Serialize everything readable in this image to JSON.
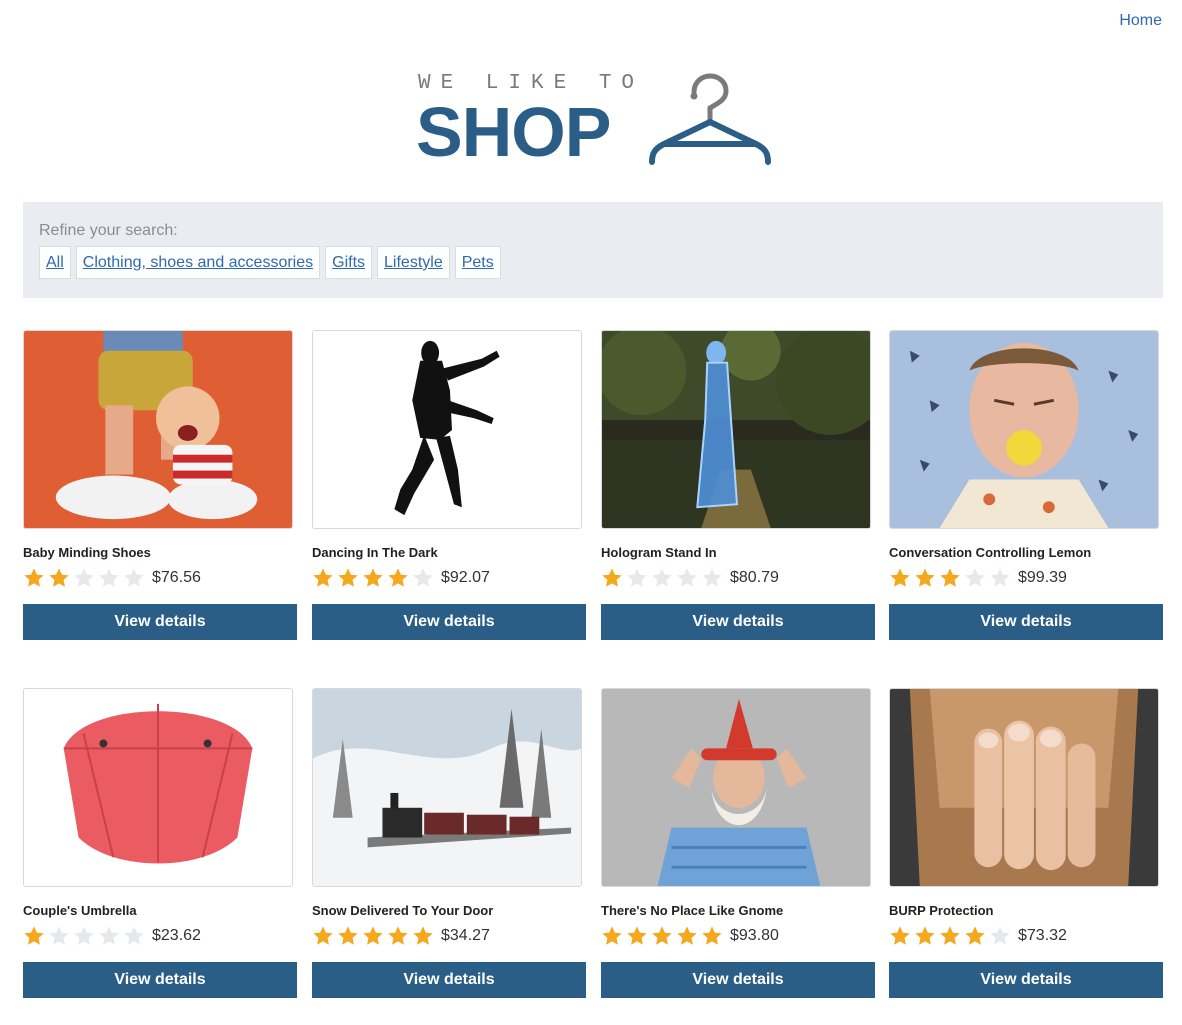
{
  "nav": {
    "home_label": "Home"
  },
  "logo": {
    "tagline": "WE LIKE TO",
    "wordmark": "SHOP"
  },
  "filter": {
    "label": "Refine your search:",
    "categories": [
      "All",
      "Clothing, shoes and accessories",
      "Gifts",
      "Lifestyle",
      "Pets"
    ]
  },
  "colors": {
    "brand": "#2a5e86",
    "link": "#2e6ab0",
    "star_on": "#f4a81d",
    "star_off": "#e6e9ec",
    "filter_bg": "#e9edf1"
  },
  "products": [
    {
      "title": "Baby Minding Shoes",
      "rating": 2,
      "price": "$76.56",
      "button": "View details",
      "image_icon": "toy-figurine-image"
    },
    {
      "title": "Dancing In The Dark",
      "rating": 4,
      "price": "$92.07",
      "button": "View details",
      "image_icon": "dancer-silhouette-image"
    },
    {
      "title": "Hologram Stand In",
      "rating": 1,
      "price": "$80.79",
      "button": "View details",
      "image_icon": "hologram-woman-image"
    },
    {
      "title": "Conversation Controlling Lemon",
      "rating": 3,
      "price": "$99.39",
      "button": "View details",
      "image_icon": "man-lemon-image"
    },
    {
      "title": "Couple's Umbrella",
      "rating": 1,
      "price": "$23.62",
      "button": "View details",
      "image_icon": "red-umbrella-image"
    },
    {
      "title": "Snow Delivered To Your Door",
      "rating": 5,
      "price": "$34.27",
      "button": "View details",
      "image_icon": "snow-train-image"
    },
    {
      "title": "There's No Place Like Gnome",
      "rating": 5,
      "price": "$93.80",
      "button": "View details",
      "image_icon": "gnome-man-image"
    },
    {
      "title": "BURP Protection",
      "rating": 4,
      "price": "$73.32",
      "button": "View details",
      "image_icon": "hand-beard-image"
    }
  ]
}
